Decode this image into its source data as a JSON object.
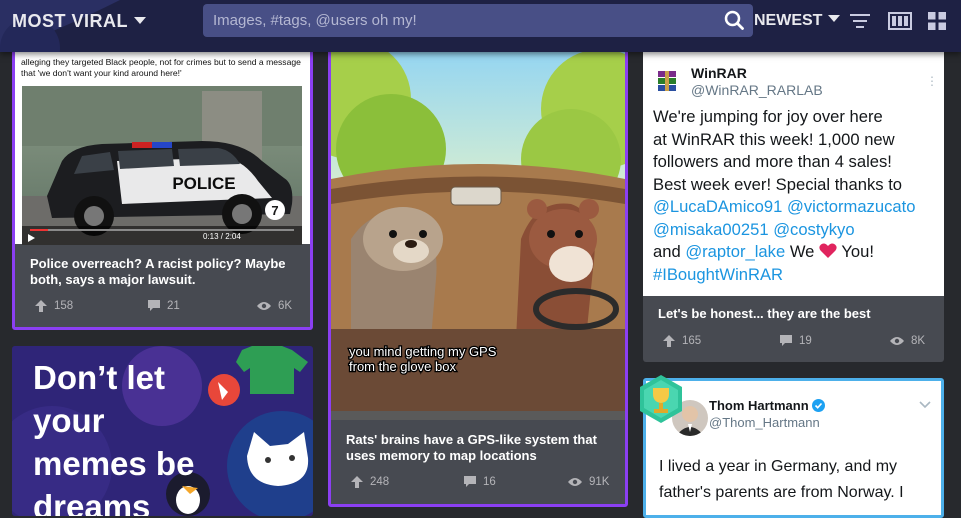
{
  "header": {
    "sort_label": "MOST VIRAL",
    "search_placeholder": "Images, #tags, @users oh my!",
    "order_label": "NEWEST"
  },
  "posts": [
    {
      "overlay_text": "alleging they targeted Black people, not for crimes but to send a message that 'we don't want your kind around here!'",
      "video_time": "0:13 / 2:04",
      "car_text": "POLICE",
      "channel_logo": "7",
      "title": "Police overreach? A racist policy? Maybe both, says a major lawsuit.",
      "upvotes": "158",
      "comments": "21",
      "views": "6K"
    },
    {
      "caption_line1": "you mind getting my GPS",
      "caption_line2": "from the glove box",
      "title": "Rats' brains have a GPS-like system that uses memory to map locations",
      "upvotes": "248",
      "comments": "16",
      "views": "91K"
    },
    {
      "author_name": "WinRAR",
      "author_handle": "@WinRAR_RARLAB",
      "tweet": {
        "l1": "We're jumping for joy over here",
        "l2": "at WinRAR this week! 1,000 new",
        "l3": "followers and more than 4 sales!",
        "l4": "Best week ever! Special thanks to",
        "m1": "@LucaDAmico91",
        "m2": "@victormazucato",
        "m3": "@misaka00251",
        "m4": "@costykyo",
        "and": "and",
        "m5": "@raptor_lake",
        "we": "We",
        "you": "You!",
        "tag": "#IBoughtWinRAR"
      },
      "title": "Let's be honest... they are the best",
      "upvotes": "165",
      "comments": "19",
      "views": "8K"
    },
    {
      "meme_text": [
        "Don’t let",
        "your",
        "memes be",
        "dreams"
      ]
    },
    {
      "author_name": "Thom Hartmann",
      "author_handle": "@Thom_Hartmann",
      "tweet_l1": "I lived a year in Germany, and my",
      "tweet_l2": "father's parents are from Norway. I"
    }
  ],
  "colors": {
    "header_bg": "#1e2144",
    "search_bg": "#484f86",
    "card_bg": "#474a51",
    "promoted_border": "#8b3ff2",
    "tweet_border": "#4db0ea",
    "link": "#1b95e0"
  },
  "icons": [
    "search-icon",
    "chevron-down-icon",
    "sort-lines-icon",
    "grid-view-icon",
    "tile-view-icon",
    "upvote-arrow-icon",
    "comment-icon",
    "eye-icon",
    "trophy-icon",
    "verified-icon",
    "heart-icon"
  ]
}
